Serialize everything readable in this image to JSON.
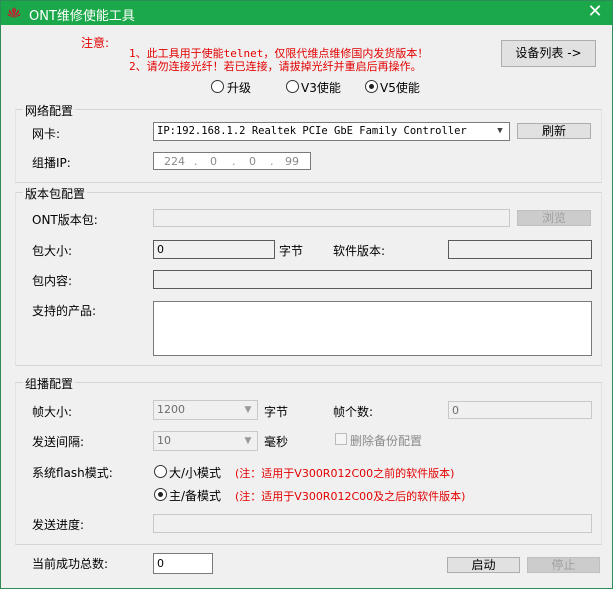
{
  "window": {
    "title": "ONT维修使能工具",
    "close_glyph": "✕"
  },
  "notice": {
    "label": "注意:",
    "line1": "1、此工具用于使能telnet，仅限代维点维修国内发货版本！",
    "line2": "2、请勿连接光纤！若已连接，请拔掉光纤并重启后再操作。"
  },
  "device_list_button": "设备列表 ->",
  "mode": {
    "options": [
      "升级",
      "V3使能",
      "V5使能"
    ],
    "selected": "V5使能"
  },
  "network": {
    "group_label": "网络配置",
    "nic_label": "网卡:",
    "nic_value": "IP:192.168.1.2 Realtek PCIe GbE Family Controller",
    "refresh_button": "刷新",
    "multicast_ip_label": "组播IP:",
    "multicast_ip": [
      "224",
      "0",
      "0",
      "99"
    ]
  },
  "package": {
    "group_label": "版本包配置",
    "ont_package_label": "ONT版本包:",
    "browse_button": "浏览",
    "size_label": "包大小:",
    "size_value": "0",
    "size_unit": "字节",
    "software_version_label": "软件版本:",
    "content_label": "包内容:",
    "supported_products_label": "支持的产品:"
  },
  "multicast": {
    "group_label": "组播配置",
    "frame_size_label": "帧大小:",
    "frame_size_value": "1200",
    "frame_size_unit": "字节",
    "frame_count_label": "帧个数:",
    "frame_count_value": "0",
    "interval_label": "发送间隔:",
    "interval_value": "10",
    "interval_unit": "毫秒",
    "delete_backup_label": "删除备份配置",
    "flash_mode_label": "系统flash模式:",
    "flash_options": [
      {
        "label": "大/小模式",
        "note": "(注：适用于V300R012C00之前的软件版本)"
      },
      {
        "label": "主/备模式",
        "note": "(注：适用于V300R012C00及之后的软件版本)"
      }
    ],
    "flash_selected": "主/备模式",
    "progress_label": "发送进度:",
    "progress": 0
  },
  "footer": {
    "success_total_label": "当前成功总数:",
    "success_total_value": "0",
    "start_button": "启动",
    "stop_button": "停止"
  },
  "colors": {
    "titlebar": "#1ba84a",
    "notice_red": "#e30000"
  }
}
